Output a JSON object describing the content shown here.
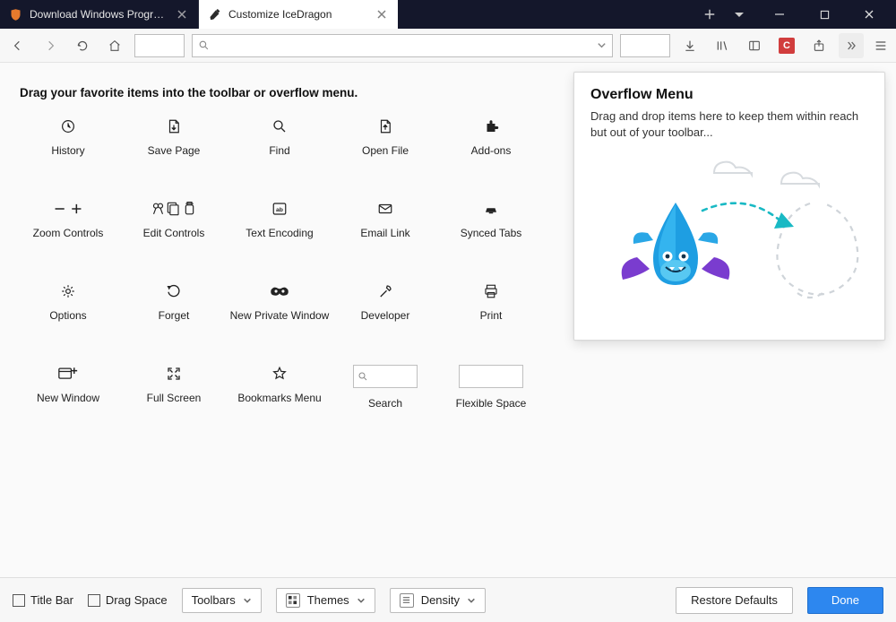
{
  "tabs": [
    {
      "title": "Download Windows Programs",
      "active": false
    },
    {
      "title": "Customize IceDragon",
      "active": true
    }
  ],
  "heading": "Drag your favorite items into the toolbar or overflow menu.",
  "items": {
    "history": "History",
    "savepage": "Save Page",
    "find": "Find",
    "openfile": "Open File",
    "addons": "Add-ons",
    "zoom": "Zoom Controls",
    "edit": "Edit Controls",
    "encoding": "Text Encoding",
    "email": "Email Link",
    "synced": "Synced Tabs",
    "options": "Options",
    "forget": "Forget",
    "private": "New Private Window",
    "developer": "Developer",
    "print": "Print",
    "newwindow": "New Window",
    "fullscreen": "Full Screen",
    "bookmarks": "Bookmarks Menu",
    "search": "Search",
    "flexible": "Flexible Space"
  },
  "overflow": {
    "title": "Overflow Menu",
    "desc": "Drag and drop items here to keep them within reach but out of your toolbar..."
  },
  "footer": {
    "titlebar": "Title Bar",
    "dragspace": "Drag Space",
    "toolbars": "Toolbars",
    "themes": "Themes",
    "density": "Density",
    "restore": "Restore Defaults",
    "done": "Done"
  }
}
